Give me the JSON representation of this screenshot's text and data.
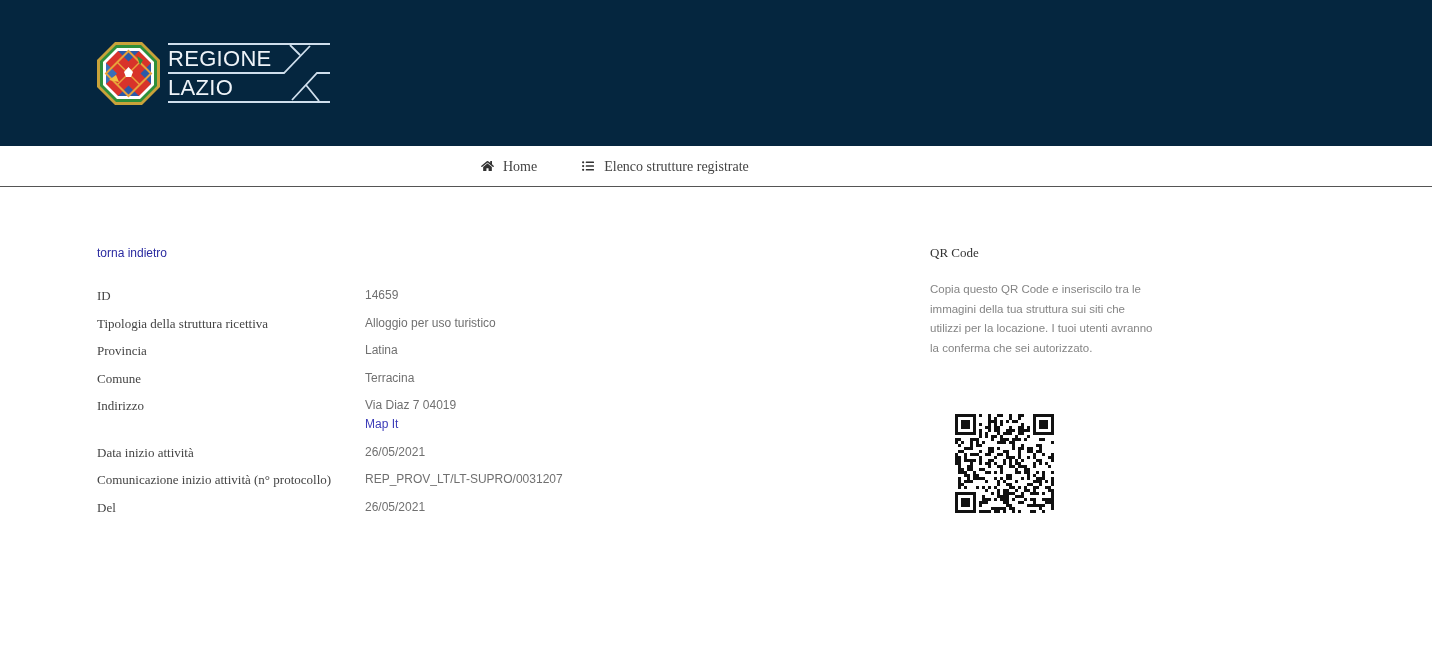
{
  "header": {
    "logo": {
      "line_1": "REGIONE",
      "line_2": "LAZIO"
    }
  },
  "nav": [
    {
      "label": "Home"
    },
    {
      "label": "Elenco strutture registrate"
    }
  ],
  "back_link": "torna indietro",
  "details": [
    {
      "label": "ID",
      "value": "14659"
    },
    {
      "label": "Tipologia della struttura ricettiva",
      "value": "Alloggio per uso turistico"
    },
    {
      "label": "Provincia",
      "value": "Latina"
    },
    {
      "label": "Comune",
      "value": "Terracina"
    },
    {
      "label": "Indirizzo",
      "value": "Via Diaz 7 04019",
      "link": "Map It"
    },
    {
      "label": "Data inizio attività",
      "value": "26/05/2021"
    },
    {
      "label": "Comunicazione inizio attività (n° protocollo)",
      "value": "REP_PROV_LT/LT-SUPRO/0031207"
    },
    {
      "label": "Del",
      "value": "26/05/2021"
    }
  ],
  "qr_panel": {
    "title": "QR Code",
    "text": "Copia questo QR Code e inseriscilo tra le immagini della tua struttura sui siti che utilizzi per la locazione. I tuoi utenti avranno la conferma che sei autorizzato."
  }
}
